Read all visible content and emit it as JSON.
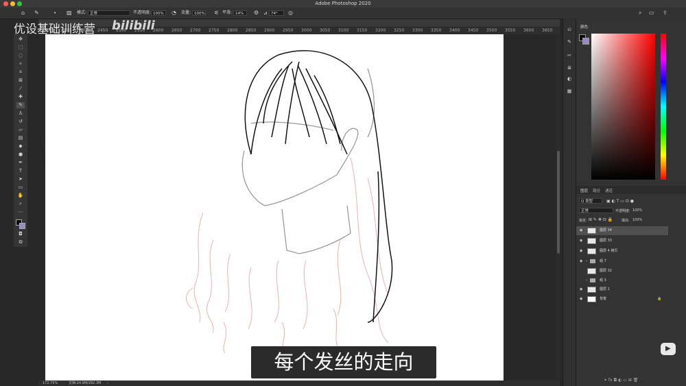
{
  "app": {
    "title": "Adobe Photoshop 2020"
  },
  "watermark": {
    "text": "优设基础训练营",
    "logo": "bilibili"
  },
  "options": {
    "mode_label": "模式:",
    "mode_value": "正常",
    "opacity_label": "不透明度:",
    "opacity_value": "100%",
    "flow_label": "流量:",
    "flow_value": "100%",
    "smooth_label": "平滑:",
    "smooth_value": "14%",
    "angle_value": "74°"
  },
  "ruler": {
    "ticks": [
      "2300",
      "2350",
      "2400",
      "2450",
      "2500",
      "2550",
      "2600",
      "2650",
      "2700",
      "2750",
      "2800",
      "2850",
      "2900",
      "2950",
      "3000",
      "3050",
      "3100",
      "3150",
      "3200",
      "3250",
      "3300",
      "3350",
      "3400",
      "3450",
      "3500",
      "3550",
      "3600",
      "3650"
    ]
  },
  "status": {
    "zoom": "172.75%",
    "doc": "文档:24.9M/282.3M"
  },
  "panels": {
    "color_tab": "颜色",
    "layers_tabs": [
      "图层",
      "路径",
      "通道"
    ],
    "kind_label": "Q 类型",
    "blend_value": "正常",
    "opacity_label": "不透明度:",
    "opacity_value": "100%",
    "lock_label": "锁定:",
    "fill_label": "填充:",
    "fill_value": "100%"
  },
  "layers": [
    {
      "name": "图层 34",
      "type": "layer",
      "visible": true,
      "selected": true
    },
    {
      "name": "图层 33",
      "type": "layer",
      "visible": true
    },
    {
      "name": "图层 4 拷贝",
      "type": "layer",
      "visible": true
    },
    {
      "name": "组 7",
      "type": "group",
      "visible": true
    },
    {
      "name": "图层 32",
      "type": "layer",
      "visible": false
    },
    {
      "name": "组 3",
      "type": "group",
      "visible": false
    },
    {
      "name": "图层 1",
      "type": "layer",
      "visible": true
    },
    {
      "name": "背景",
      "type": "layer",
      "visible": true,
      "locked": true
    }
  ],
  "subtitle": "每个发丝的走向",
  "colors": {
    "foreground": "#0b0b0b",
    "background": "#9c88c8",
    "accent": "#ff0000"
  }
}
